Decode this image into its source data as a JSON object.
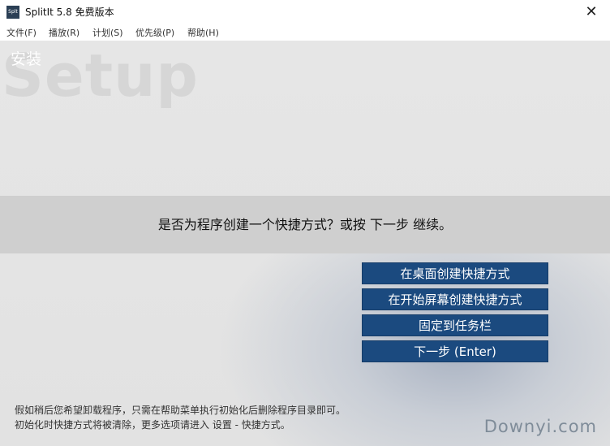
{
  "window": {
    "icon_text": "Splt",
    "title": "SplitIt 5.8 免费版本",
    "close_glyph": "✕"
  },
  "menu": [
    {
      "label": "文件(F)"
    },
    {
      "label": "播放(R)"
    },
    {
      "label": "计划(S)"
    },
    {
      "label": "优先级(P)"
    },
    {
      "label": "帮助(H)"
    }
  ],
  "page": {
    "title": "安装",
    "watermark_word": "Setup",
    "question": "是否为程序创建一个快捷方式？或按 下一步 继续。"
  },
  "buttons": [
    {
      "label": "在桌面创建快捷方式"
    },
    {
      "label": "在开始屏幕创建快捷方式"
    },
    {
      "label": "固定到任务栏"
    },
    {
      "label": "下一步 (Enter)"
    }
  ],
  "footer": {
    "line1": "假如稍后您希望卸载程序，只需在帮助菜单执行初始化后删除程序目录即可。",
    "line2": "初始化时快捷方式将被清除，更多选项请进入 设置 - 快捷方式。"
  },
  "site_watermark": "Downyi.com",
  "colors": {
    "button_bg": "#1b4a7f",
    "band_bg": "#cfcfcf",
    "content_bg": "#e4e4e4"
  }
}
